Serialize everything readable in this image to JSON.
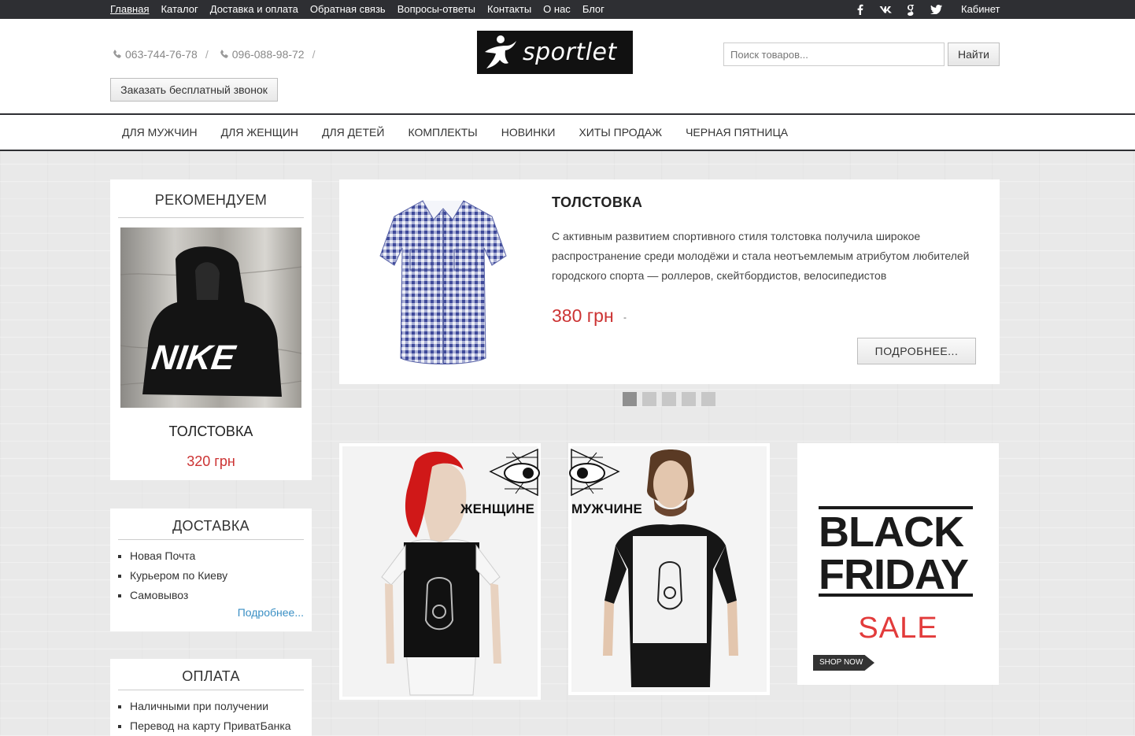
{
  "topnav": {
    "items": [
      "Главная",
      "Каталог",
      "Доставка и оплата",
      "Обратная связь",
      "Вопросы-ответы",
      "Контакты",
      "О нас",
      "Блог"
    ],
    "cabinet": "Кабинет"
  },
  "social": [
    "facebook-icon",
    "vk-icon",
    "google-plus-icon",
    "twitter-icon"
  ],
  "header": {
    "phone1": "063-744-76-78",
    "phone2": "096-088-98-72",
    "separator": "/",
    "callback_label": "Заказать бесплатный звонок",
    "logo_text": "sportlet",
    "search_placeholder": "Поиск товаров...",
    "search_button": "Найти"
  },
  "mainnav": {
    "items": [
      "ДЛЯ МУЖЧИН",
      "ДЛЯ ЖЕНЩИН",
      "ДЛЯ ДЕТЕЙ",
      "КОМПЛЕКТЫ",
      "НОВИНКИ",
      "ХИТЫ ПРОДАЖ",
      "ЧЕРНАЯ ПЯТНИЦА"
    ]
  },
  "sidebar": {
    "recommend": {
      "title": "РЕКОМЕНДУЕМ",
      "image_text": "NIKE",
      "product_name": "ТОЛСТОВКА",
      "price": "320 грн"
    },
    "delivery": {
      "title": "ДОСТАВКА",
      "items": [
        "Новая Почта",
        "Курьером по Киеву",
        "Самовывоз"
      ],
      "more": "Подробнее..."
    },
    "payment": {
      "title": "ОПЛАТА",
      "items": [
        "Наличными при получении",
        "Перевод на карту ПриватБанка"
      ]
    }
  },
  "slider": {
    "title": "ТОЛСТОВКА",
    "description": "С активным развитием спортивного стиля толстовка получила широкое распространение среди молодёжи и стала неотъемлемым атрибутом любителей городского спорта — роллеров, скейтбордистов, велосипедистов",
    "price": "380 грн",
    "price_mark": "-",
    "more_button": "ПОДРОБНЕЕ...",
    "dots_count": 5,
    "active_dot": 1
  },
  "banners": {
    "women_label": "ЖЕНЩИНЕ",
    "men_label": "МУЖЧИНЕ",
    "sale": {
      "line1": "BLACK",
      "line2": "FRIDAY",
      "sale_word": "SALE",
      "shop_now": "SHOP NOW"
    }
  },
  "colors": {
    "topbar": "#2e2f33",
    "price_red": "#cc3333",
    "link_blue": "#3a8fc4",
    "sale_red": "#e23b3b"
  }
}
